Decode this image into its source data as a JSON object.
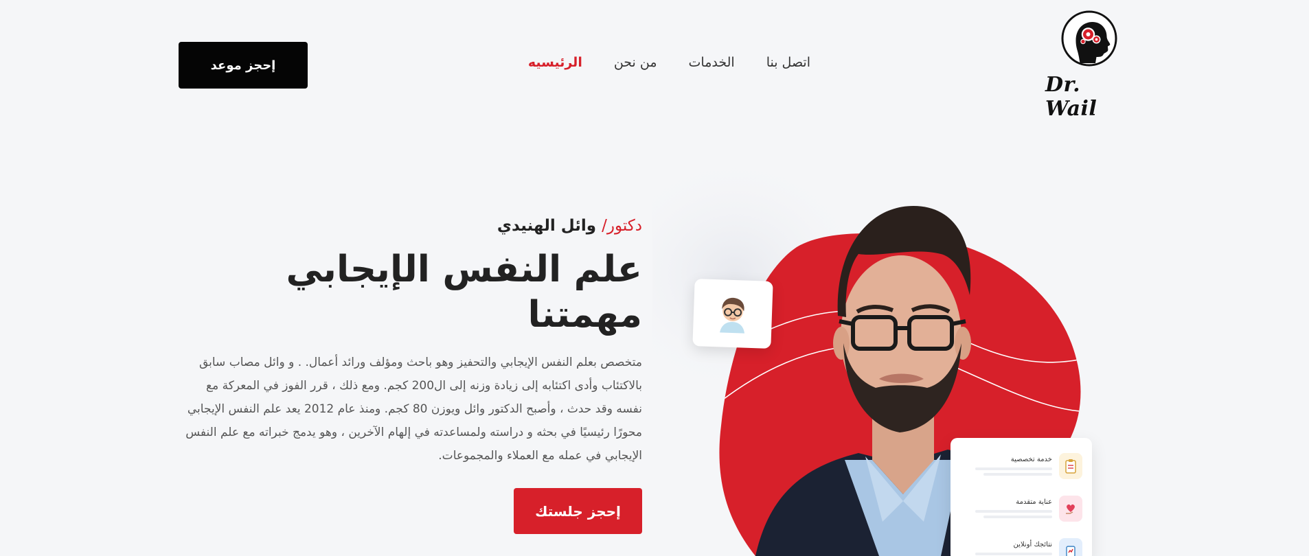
{
  "brand": {
    "logo_text": "Dr. Wail"
  },
  "nav": {
    "items": [
      {
        "label": "الرئيسيه",
        "active": true
      },
      {
        "label": "من نحن",
        "active": false
      },
      {
        "label": "الخدمات",
        "active": false
      },
      {
        "label": "اتصل بنا",
        "active": false
      }
    ]
  },
  "header": {
    "book_button": "إحجز موعد"
  },
  "hero": {
    "subtitle_prefix": "دكتور/",
    "subtitle_name": " وائل الهنيدي",
    "headline": "علم النفس الإيجابي مهمتنا",
    "description": "متخصص بعلم النفس الإيجابي والتحفيز وهو باحث ومؤلف ورائد أعمال. . و وائل مصاب سابق بالاكتئاب وأدى اكتئابه إلى زيادة وزنه إلى ال200 كجم. ومع ذلك ، قرر الفوز في المعركة مع نفسه وقد حدث ، وأصبح الدكتور وائل ويوزن 80 كجم. ومنذ عام 2012 يعد علم النفس الإيجابي محورًا رئيسيًا في بحثه و دراسته ولمساعدته في إلهام الآخرين ، وهو يدمج خبراته مع علم النفس الإيجابي في عمله مع العملاء والمجموعات.",
    "session_button": "إحجز جلستك"
  },
  "services_card": {
    "items": [
      {
        "label": "خدمة تخصصية",
        "icon": "clipboard-icon",
        "bg": "#fdf3dd"
      },
      {
        "label": "عناية متقدمة",
        "icon": "heart-hand-icon",
        "bg": "#fde4ea"
      },
      {
        "label": "نتائجك أونلاين",
        "icon": "report-icon",
        "bg": "#e3eefc"
      }
    ]
  },
  "colors": {
    "accent": "#d7202a",
    "dark": "#050505",
    "background": "#f5f6f8"
  }
}
